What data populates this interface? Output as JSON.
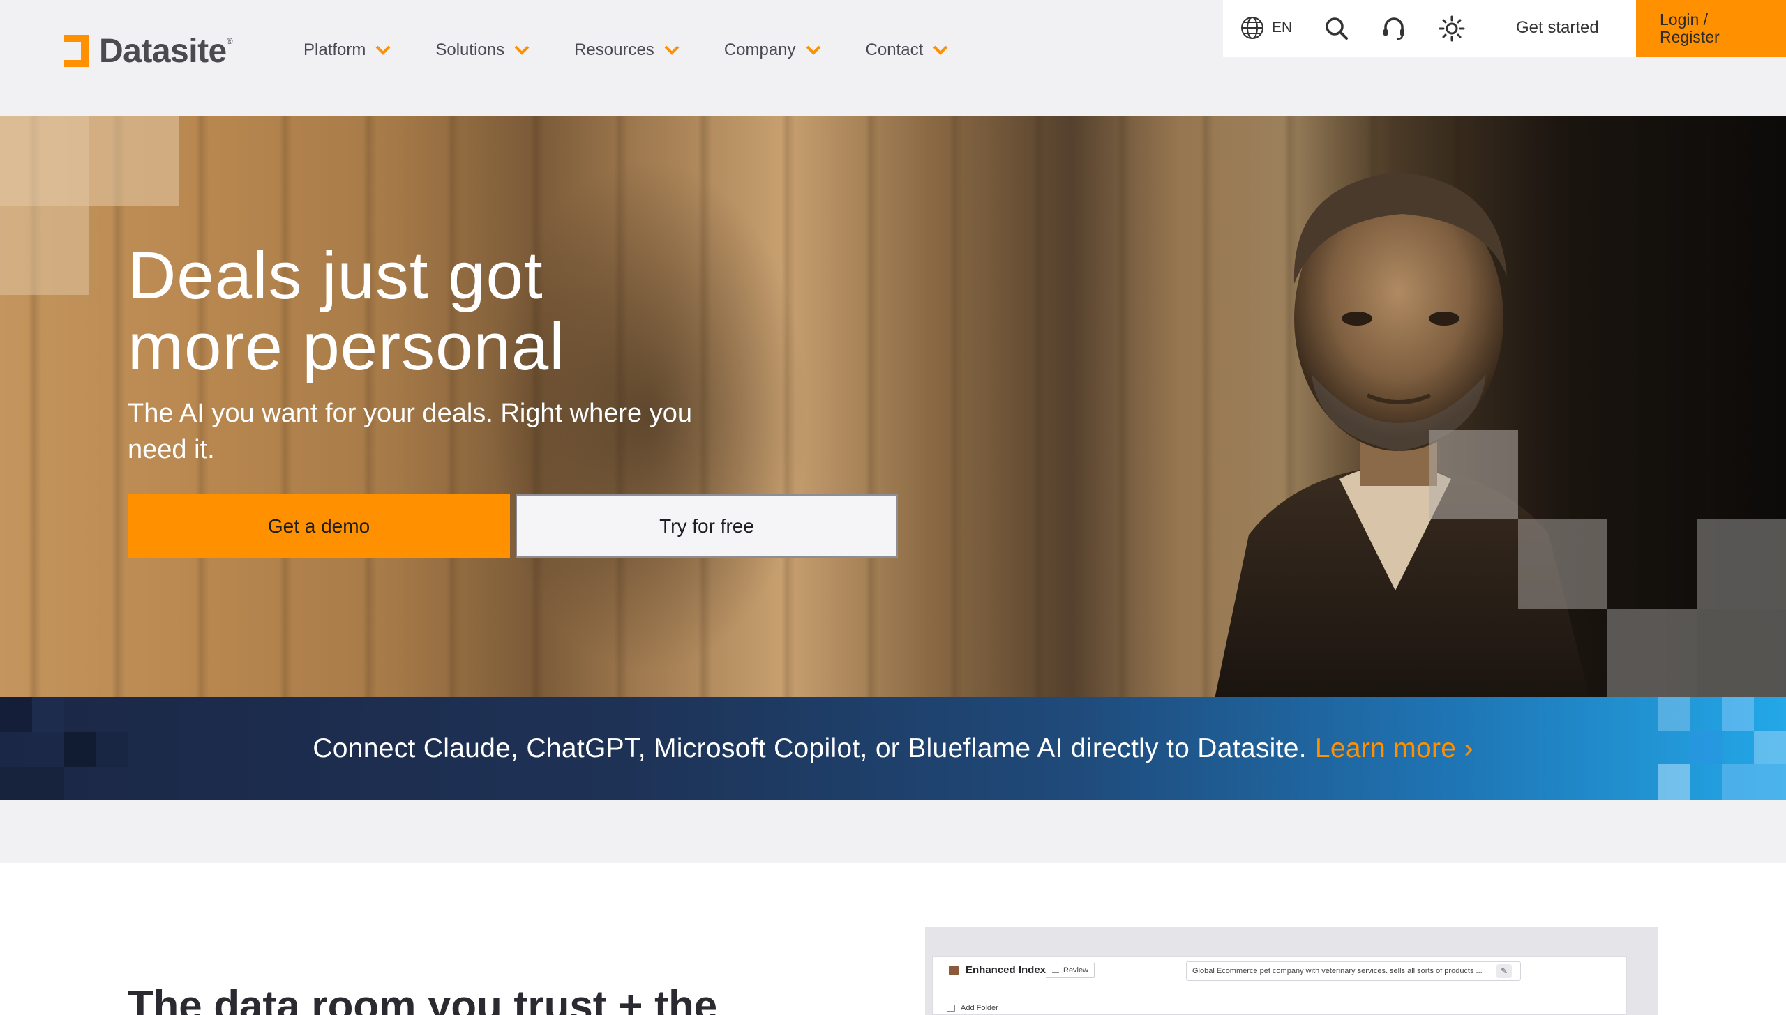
{
  "brand": {
    "name": "Datasite",
    "registered": "®"
  },
  "nav": {
    "items": [
      {
        "label": "Platform"
      },
      {
        "label": "Solutions"
      },
      {
        "label": "Resources"
      },
      {
        "label": "Company"
      },
      {
        "label": "Contact"
      }
    ]
  },
  "utility": {
    "language": "EN",
    "get_started": "Get started",
    "login": "Login /\nRegister"
  },
  "hero": {
    "title_line1": "Deals just got",
    "title_line2": "more personal",
    "subtitle": "The AI you want for your deals. Right where you need it.",
    "primary_cta": "Get a demo",
    "secondary_cta": "Try for free"
  },
  "banner": {
    "text": "Connect Claude, ChatGPT, Microsoft Copilot, or Blueflame AI directly to Datasite.",
    "link": "Learn more",
    "link_arrow": "›"
  },
  "section": {
    "title": "The data room you trust + the"
  },
  "preview": {
    "title": "Enhanced Index",
    "review_label": "Review",
    "description": "Global Ecommerce pet company with veterinary services. sells all sorts of products ...",
    "add_folder": "Add Folder"
  },
  "colors": {
    "accent": "#ff9100",
    "header_bg": "#f1f1f4",
    "banner_start": "#1b2746",
    "banner_end": "#23a8e8"
  },
  "icons": {
    "language": "globe-icon",
    "search": "search-icon",
    "support": "headset-icon",
    "theme": "sun-icon",
    "dropdown": "chevron-down-icon"
  }
}
